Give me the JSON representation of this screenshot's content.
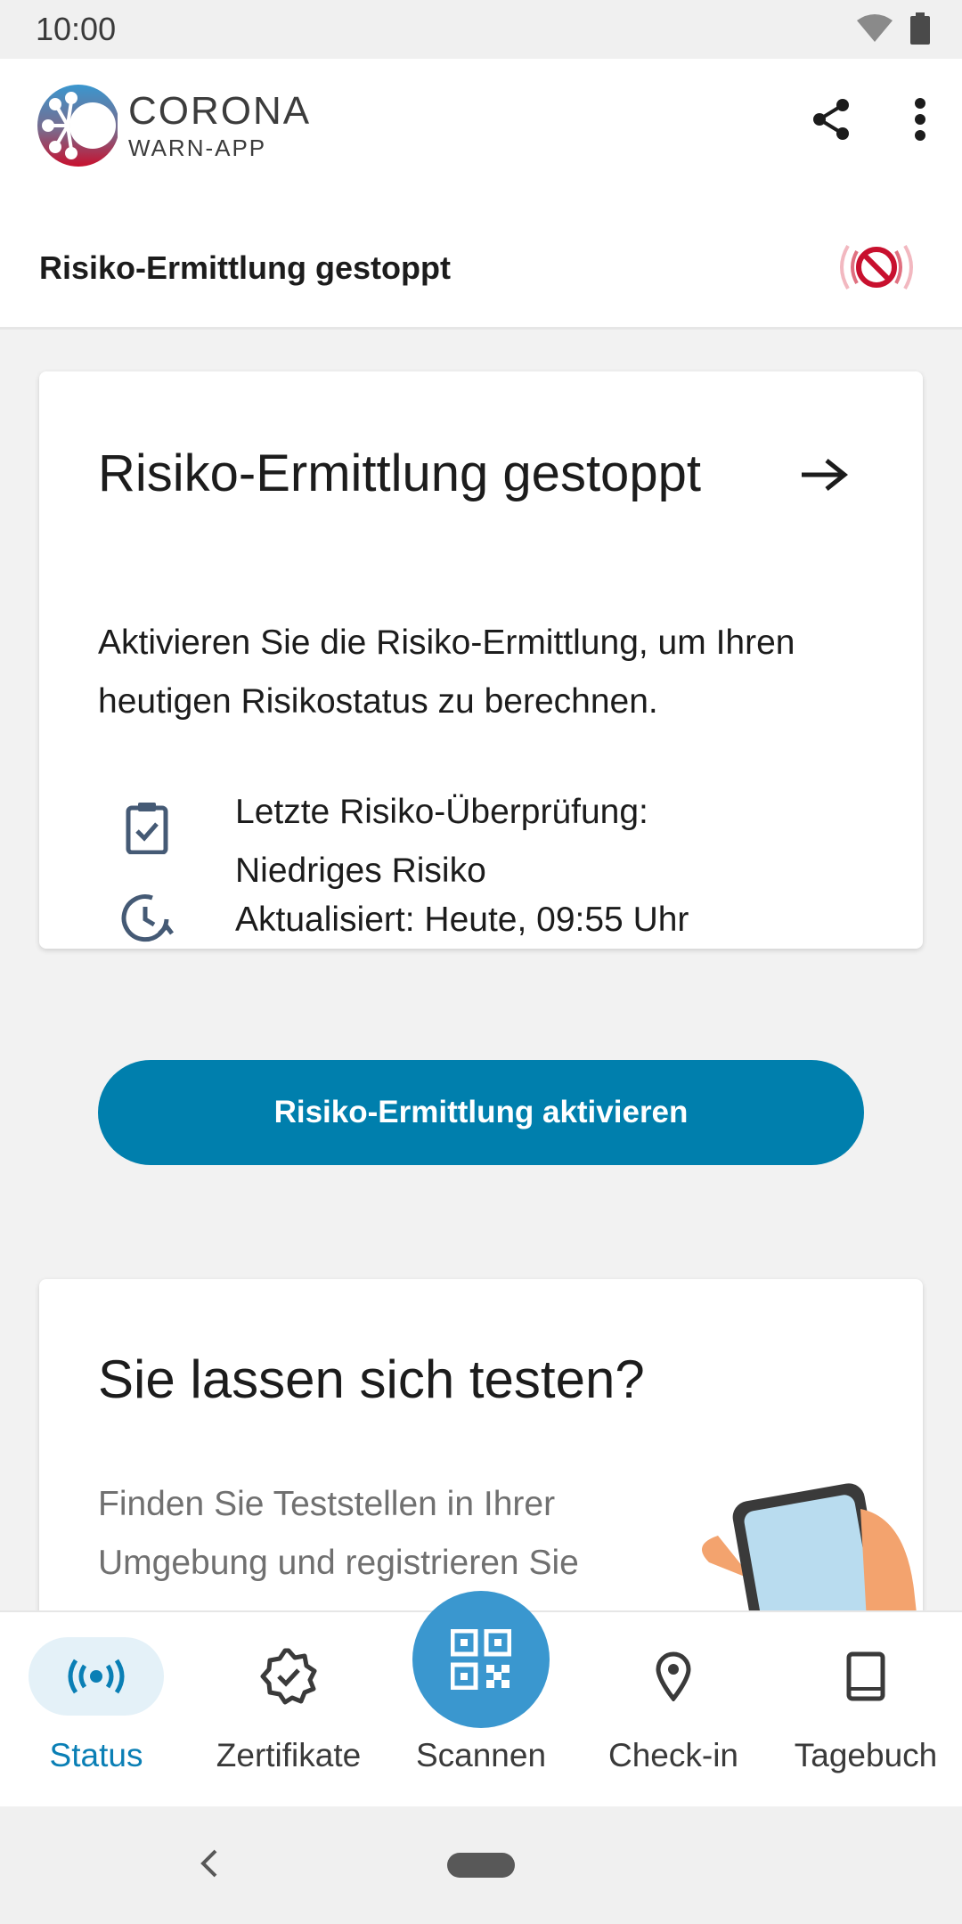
{
  "status_bar": {
    "time": "10:00",
    "wifi_icon": "wifi-icon",
    "battery_icon": "battery-icon"
  },
  "app_bar": {
    "logo_title": "CORONA",
    "logo_subtitle": "WARN-APP",
    "share_icon": "share-icon",
    "menu_icon": "more-vert-icon"
  },
  "risk_bar": {
    "label": "Risiko-Ermittlung gestoppt",
    "icon": "tracing-off-icon"
  },
  "risk_card": {
    "title": "Risiko-Ermittlung gestoppt",
    "body": "Aktivieren Sie die Risiko-Ermittlung, um Ihren heutigen Risikostatus zu berechnen.",
    "last_check": "Letzte Risiko-Überprüfung: Niedriges Risiko",
    "updated": "Aktualisiert: Heute, 09:55 Uhr",
    "button_label": "Risiko-Ermittlung aktivieren"
  },
  "test_card": {
    "title": "Sie lassen sich testen?",
    "body": "Finden Sie Teststellen in Ihrer Umgebung und registrieren Sie"
  },
  "bottom_nav": {
    "items": [
      {
        "label": "Status",
        "icon": "radar-icon",
        "active": true
      },
      {
        "label": "Zertifikate",
        "icon": "certificate-icon",
        "active": false
      },
      {
        "label": "Scannen",
        "icon": "qr-code-icon",
        "active": false
      },
      {
        "label": "Check-in",
        "icon": "location-pin-icon",
        "active": false
      },
      {
        "label": "Tagebuch",
        "icon": "book-icon",
        "active": false
      }
    ]
  },
  "colors": {
    "primary": "#007fad",
    "accent_red": "#c8102e",
    "nav_active": "#0a7fb5",
    "fab": "#3a97cf"
  }
}
